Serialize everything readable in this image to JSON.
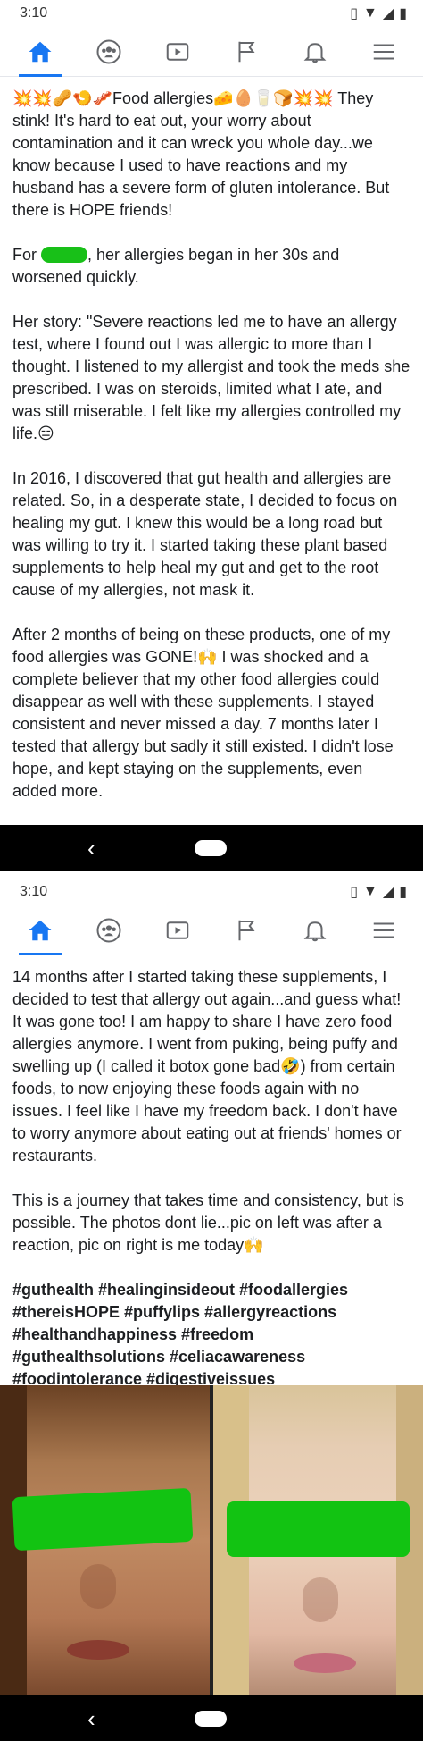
{
  "screens": [
    {
      "status": {
        "time": "3:10"
      },
      "post": {
        "p1": "💥💥🥜🍤🥓Food allergies🧀🥚🥛🍞💥💥 They stink! It's hard to eat out, your worry about contamination and it can wreck you whole day...we know because I used to have reactions and my husband has a severe form of gluten intolerance. But there is HOPE friends!",
        "p2_before": "For ",
        "p2_after": ", her allergies began in her 30s and worsened quickly.",
        "p3": "Her story: \"Severe reactions led me to have an allergy test, where I found out I was allergic to more than I thought. I listened to my allergist and took the meds she prescribed. I was on steroids, limited what I ate, and was still miserable. I felt like my allergies controlled my life.😑",
        "p4": "In 2016, I discovered that gut health and allergies are related. So, in a desperate state, I decided to focus on healing my gut. I knew this would be a long road but was willing to try it. I started taking these plant based supplements to help heal my gut and get to the root cause of my allergies, not mask it.",
        "p5": "After 2 months of being on these products, one of my food allergies was GONE!🙌 I was shocked and a complete believer that my other food allergies could disappear as well with these supplements. I stayed consistent and never missed a day. 7 months later I tested that allergy but sadly it still existed. I didn't lose hope, and kept staying on the supplements, even added more."
      }
    },
    {
      "status": {
        "time": "3:10"
      },
      "post": {
        "p1": "14 months after I started taking these supplements, I decided to test that allergy out again...and guess what! It was gone too! I am happy to share I have zero food allergies anymore. I went from puking, being puffy and swelling up (I called it botox gone bad🤣) from certain foods, to now enjoying these foods again with no issues. I feel like I have my freedom back. I don't have to worry anymore about eating out at friends' homes or restaurants.",
        "p2": "This is a journey that takes time and consistency, but is possible. The photos dont lie...pic on left was after a reaction, pic on right is me today🙌",
        "hashtags": "#guthealth #healinginsideout #foodallergies #thereisHOPE #puffylips #allergyreactions #healthandhappiness #freedom #guthealthsolutions #celiacawareness #foodintolerance #digestiveissues"
      }
    }
  ],
  "nav_icons": [
    "home-icon",
    "groups-icon",
    "watch-icon",
    "pages-flag-icon",
    "notifications-bell-icon",
    "menu-icon"
  ],
  "colors": {
    "accent": "#1877f2",
    "redaction": "#12c312"
  },
  "android_nav": {
    "back_glyph": "‹"
  }
}
